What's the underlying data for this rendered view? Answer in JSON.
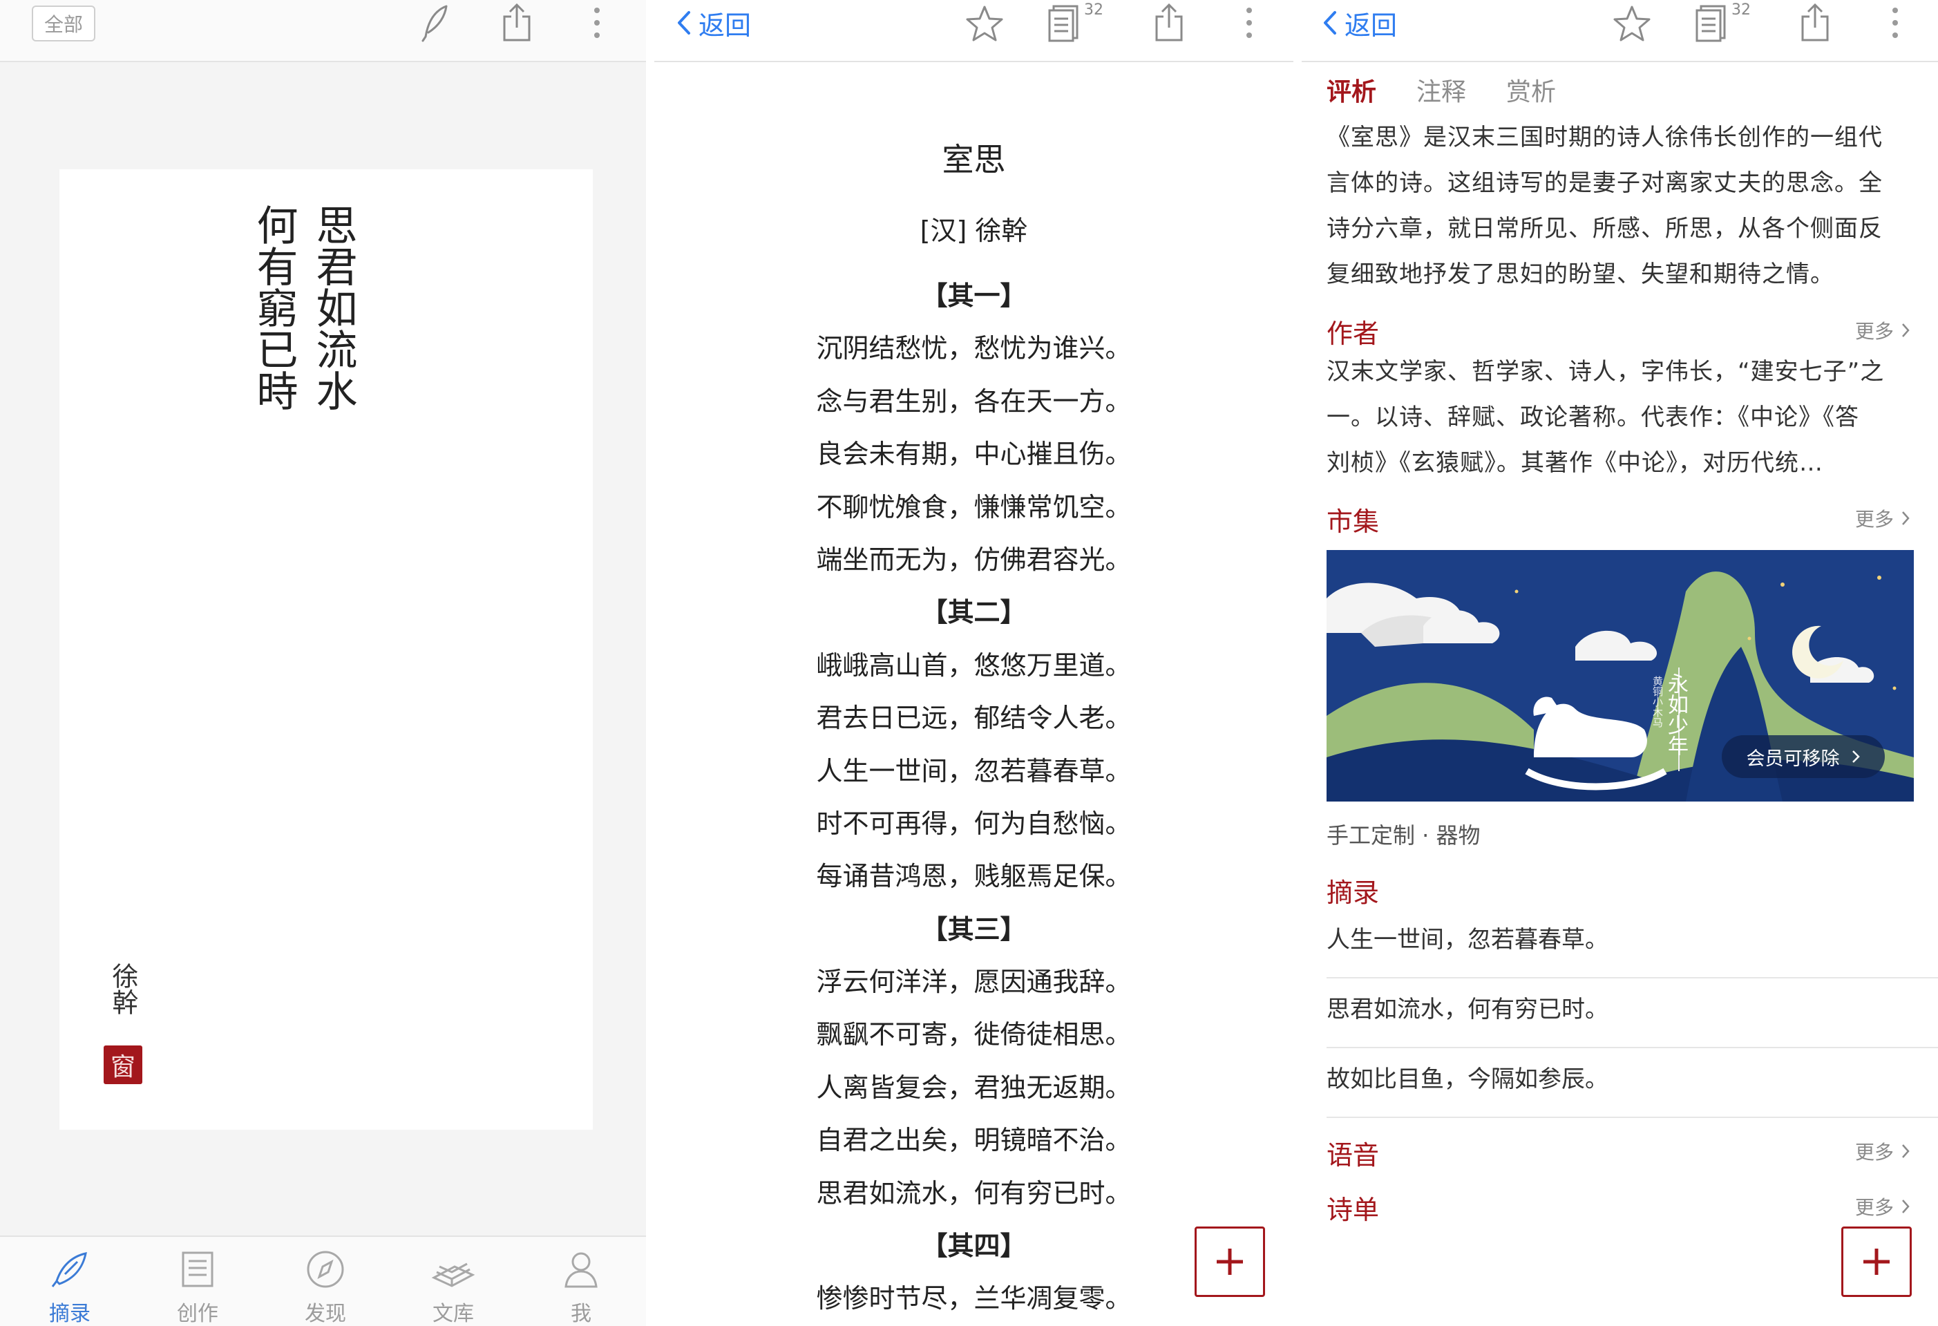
{
  "colors": {
    "accent_red": "#a3171c",
    "link_blue": "#2f7df0",
    "banner_navy": "#1c3f86",
    "banner_green": "#9cbd7a"
  },
  "panel1": {
    "all_label": "全部",
    "icons": [
      "quill-icon",
      "share-icon",
      "more-vertical-icon"
    ],
    "card": {
      "col_right": "思君如流水",
      "col_left": "何有窮已時",
      "author": "徐幹",
      "seal": "窗"
    },
    "tabs": [
      {
        "label": "摘录",
        "icon": "quill-icon",
        "active": true
      },
      {
        "label": "创作",
        "icon": "document-icon",
        "active": false
      },
      {
        "label": "发现",
        "icon": "compass-icon",
        "active": false
      },
      {
        "label": "文库",
        "icon": "books-icon",
        "active": false
      },
      {
        "label": "我",
        "icon": "person-icon",
        "active": false
      }
    ]
  },
  "panel2": {
    "back_label": "返回",
    "list_count": "32",
    "title": "室思",
    "author": "[汉] 徐幹",
    "lines": [
      {
        "text": "【其一】",
        "section": true
      },
      {
        "text": "沉阴结愁忧，愁忧为谁兴。",
        "section": false
      },
      {
        "text": "念与君生别，各在天一方。",
        "section": false
      },
      {
        "text": "良会未有期，中心摧且伤。",
        "section": false
      },
      {
        "text": "不聊忧飧食，慊慊常饥空。",
        "section": false
      },
      {
        "text": "端坐而无为，仿佛君容光。",
        "section": false
      },
      {
        "text": "【其二】",
        "section": true
      },
      {
        "text": "峨峨高山首，悠悠万里道。",
        "section": false
      },
      {
        "text": "君去日已远，郁结令人老。",
        "section": false
      },
      {
        "text": "人生一世间，忽若暮春草。",
        "section": false
      },
      {
        "text": "时不可再得，何为自愁恼。",
        "section": false
      },
      {
        "text": "每诵昔鸿恩，贱躯焉足保。",
        "section": false
      },
      {
        "text": "【其三】",
        "section": true
      },
      {
        "text": "浮云何洋洋，愿因通我辞。",
        "section": false
      },
      {
        "text": "飘飖不可寄，徙倚徒相思。",
        "section": false
      },
      {
        "text": "人离皆复会，君独无返期。",
        "section": false
      },
      {
        "text": "自君之出矣，明镜暗不治。",
        "section": false
      },
      {
        "text": "思君如流水，何有穷已时。",
        "section": false
      },
      {
        "text": "【其四】",
        "section": true
      },
      {
        "text": "惨惨时节尽，兰华凋复零。",
        "section": false
      }
    ]
  },
  "panel3": {
    "back_label": "返回",
    "list_count": "32",
    "tabs": [
      {
        "label": "评析",
        "active": true
      },
      {
        "label": "注释",
        "active": false
      },
      {
        "label": "赏析",
        "active": false
      }
    ],
    "analysis_lines": [
      "《室思》是汉末三国时期的诗人徐伟长创作的一组代",
      "言体的诗。这组诗写的是妻子对离家丈夫的思念。全",
      "诗分六章，就日常所见、所感、所思，从各个侧面反",
      "复细致地抒发了思妇的盼望、失望和期待之情。"
    ],
    "author_head": "作者",
    "more_label": "更多",
    "author_lines": [
      "汉末文学家、哲学家、诗人，字伟长，“建安七子”之",
      "一。以诗、辞赋、政论著称。代表作：《中论》《答",
      "刘桢》《玄猿赋》。其著作《中论》，对历代统…"
    ],
    "market_head": "市集",
    "banner": {
      "title": "永如少年",
      "subtitle": "黄铜小木马",
      "pill": "会员可移除"
    },
    "banner_caption": "手工定制 · 器物",
    "excerpt_head": "摘录",
    "excerpts": [
      "人生一世间，忽若暮春草。",
      "思君如流水，何有穷已时。",
      "故如比目鱼，今隔如参辰。"
    ],
    "voice_head": "语音",
    "list_head": "诗单"
  }
}
